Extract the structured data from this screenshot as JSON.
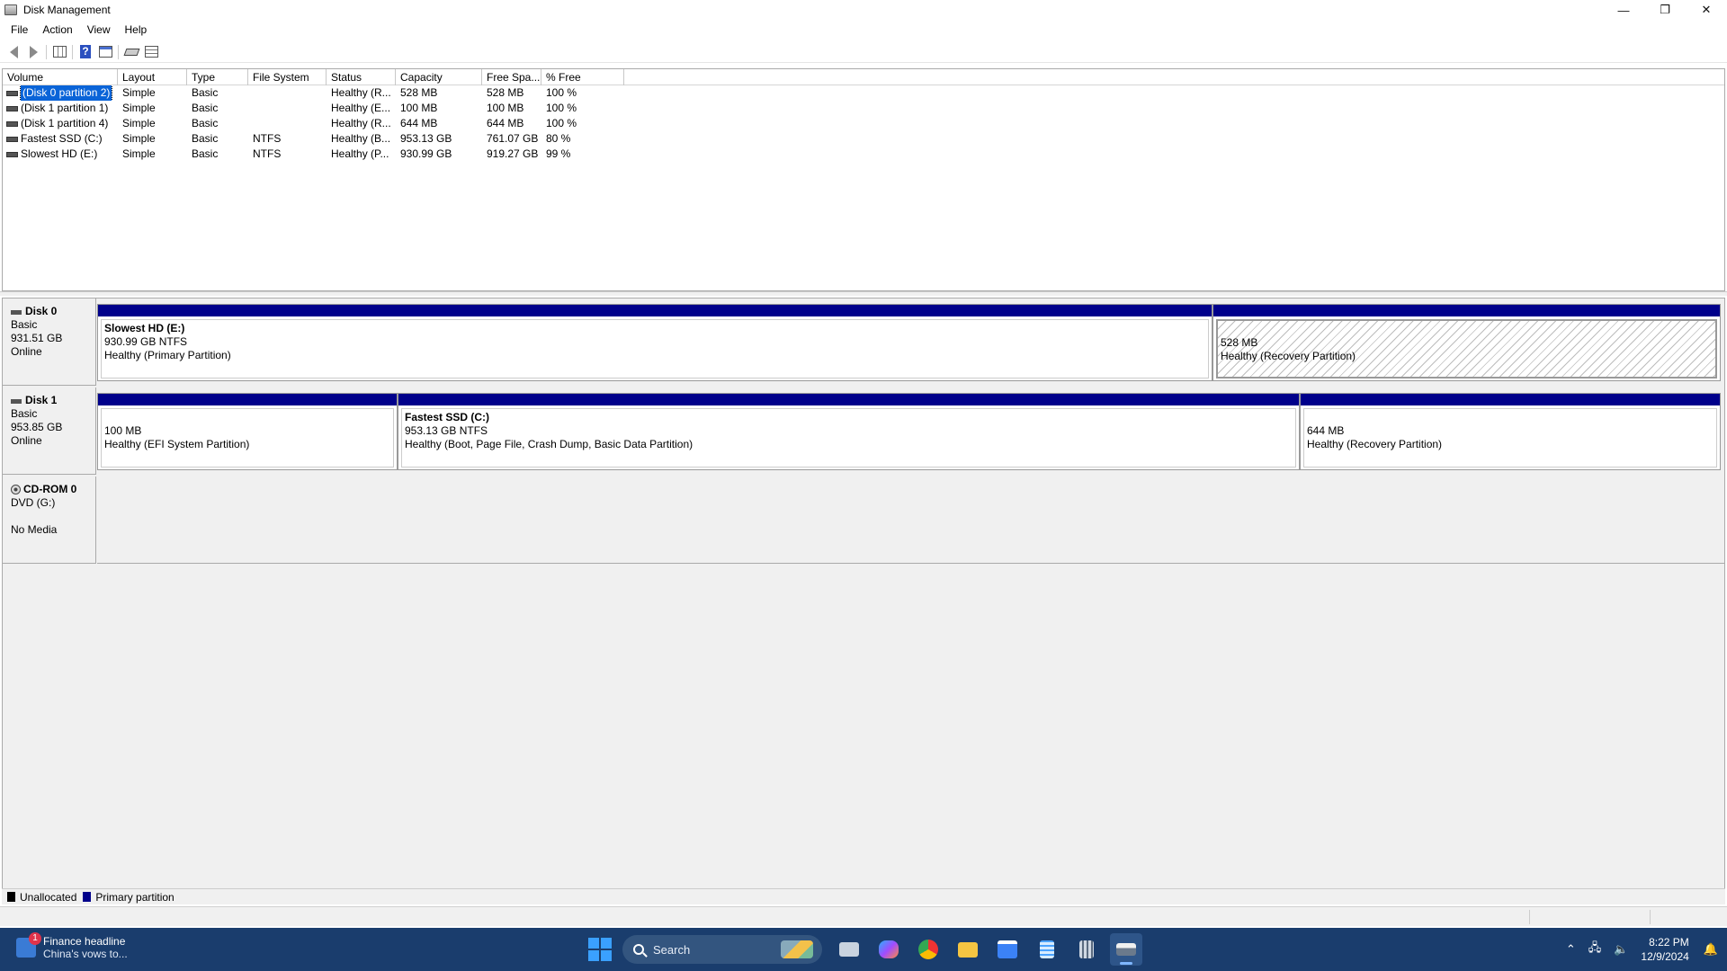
{
  "window": {
    "title": "Disk Management",
    "controls": {
      "minimize": "—",
      "restore": "❐",
      "close": "✕"
    }
  },
  "menu": [
    "File",
    "Action",
    "View",
    "Help"
  ],
  "volume_table": {
    "columns": [
      "Volume",
      "Layout",
      "Type",
      "File System",
      "Status",
      "Capacity",
      "Free Spa...",
      "% Free"
    ],
    "rows": [
      [
        "(Disk 0 partition 2)",
        "Simple",
        "Basic",
        "",
        "Healthy (R...",
        "528 MB",
        "528 MB",
        "100 %"
      ],
      [
        "(Disk 1 partition 1)",
        "Simple",
        "Basic",
        "",
        "Healthy (E...",
        "100 MB",
        "100 MB",
        "100 %"
      ],
      [
        "(Disk 1 partition 4)",
        "Simple",
        "Basic",
        "",
        "Healthy (R...",
        "644 MB",
        "644 MB",
        "100 %"
      ],
      [
        "Fastest SSD (C:)",
        "Simple",
        "Basic",
        "NTFS",
        "Healthy (B...",
        "953.13 GB",
        "761.07 GB",
        "80 %"
      ],
      [
        "Slowest HD (E:)",
        "Simple",
        "Basic",
        "NTFS",
        "Healthy (P...",
        "930.99 GB",
        "919.27 GB",
        "99 %"
      ]
    ]
  },
  "disks": [
    {
      "name": "Disk 0",
      "type": "Basic",
      "size": "931.51 GB",
      "state": "Online",
      "partitions": [
        {
          "name": "Slowest HD  (E:)",
          "size": "930.99 GB NTFS",
          "status": "Healthy (Primary Partition)"
        },
        {
          "name": "",
          "size": "528 MB",
          "status": "Healthy (Recovery Partition)"
        }
      ]
    },
    {
      "name": "Disk 1",
      "type": "Basic",
      "size": "953.85 GB",
      "state": "Online",
      "partitions": [
        {
          "name": "",
          "size": "100 MB",
          "status": "Healthy (EFI System Partition)"
        },
        {
          "name": "Fastest SSD  (C:)",
          "size": "953.13 GB NTFS",
          "status": "Healthy (Boot, Page File, Crash Dump, Basic Data Partition)"
        },
        {
          "name": "",
          "size": "644 MB",
          "status": "Healthy (Recovery Partition)"
        }
      ]
    }
  ],
  "cdrom": {
    "name": "CD-ROM 0",
    "drive": "DVD (G:)",
    "state": "No Media"
  },
  "legend": [
    {
      "label": "Unallocated",
      "color": "#000000"
    },
    {
      "label": "Primary partition",
      "color": "#00008b"
    }
  ],
  "taskbar": {
    "news_title": "Finance headline",
    "news_sub": "China's vows to...",
    "news_badge": "1",
    "search_label": "Search",
    "time": "8:22 PM",
    "date": "12/9/2024"
  },
  "colors": {
    "primary_partition": "#00008b",
    "taskbar": "#1a3d6d",
    "selection": "#0a64d8"
  }
}
